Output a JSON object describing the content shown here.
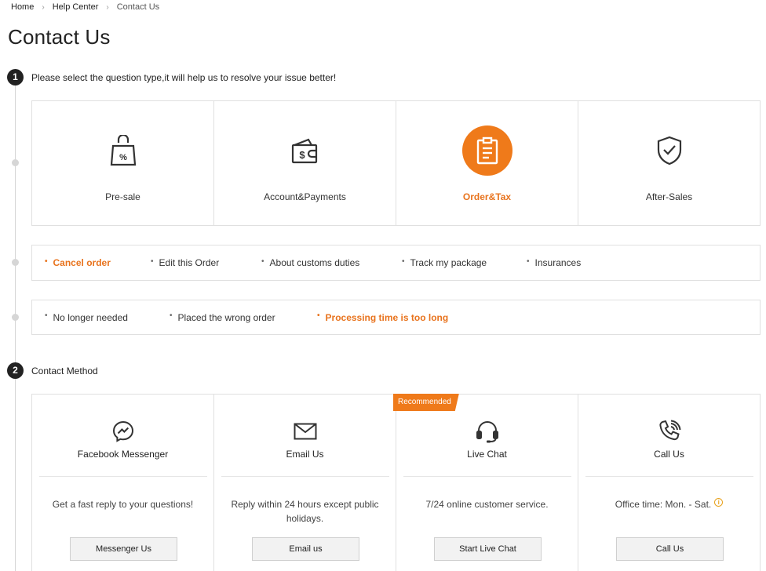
{
  "breadcrumb": {
    "items": [
      "Home",
      "Help Center",
      "Contact Us"
    ],
    "separator": "›"
  },
  "page_title": "Contact Us",
  "step1": {
    "number": "1",
    "label": "Please select the question type,it will help us to resolve your issue better!"
  },
  "question_types": [
    {
      "label": "Pre-sale",
      "icon": "shopping-bag-percent-icon",
      "active": false
    },
    {
      "label": "Account&Payments",
      "icon": "wallet-dollar-icon",
      "active": false
    },
    {
      "label": "Order&Tax",
      "icon": "clipboard-icon",
      "active": true
    },
    {
      "label": "After-Sales",
      "icon": "shield-check-icon",
      "active": false
    }
  ],
  "order_topics": [
    {
      "label": "Cancel order",
      "active": true
    },
    {
      "label": "Edit this Order",
      "active": false
    },
    {
      "label": "About customs duties",
      "active": false
    },
    {
      "label": "Track my package",
      "active": false
    },
    {
      "label": "Insurances",
      "active": false
    }
  ],
  "cancel_reasons": [
    {
      "label": "No longer needed",
      "active": false
    },
    {
      "label": "Placed the wrong order",
      "active": false
    },
    {
      "label": "Processing time is too long",
      "active": true
    }
  ],
  "step2": {
    "number": "2",
    "label": "Contact Method"
  },
  "contact_methods": [
    {
      "name": "Facebook Messenger",
      "icon": "messenger-icon",
      "desc": "Get a fast reply to your questions!",
      "button": "Messenger Us"
    },
    {
      "name": "Email Us",
      "icon": "envelope-icon",
      "desc": "Reply within 24 hours except public holidays.",
      "button": "Email us",
      "badge": ""
    },
    {
      "name": "Live Chat",
      "icon": "headset-icon",
      "desc": "7/24 online customer service.",
      "button": "Start Live Chat",
      "badge": "Recommended"
    },
    {
      "name": "Call Us",
      "icon": "phone-icon",
      "desc": "Office time: Mon. - Sat.",
      "button": "Call Us"
    }
  ],
  "colors": {
    "accent": "#ef7a1a",
    "accent_text": "#e8731d",
    "info": "#e8a21d"
  }
}
